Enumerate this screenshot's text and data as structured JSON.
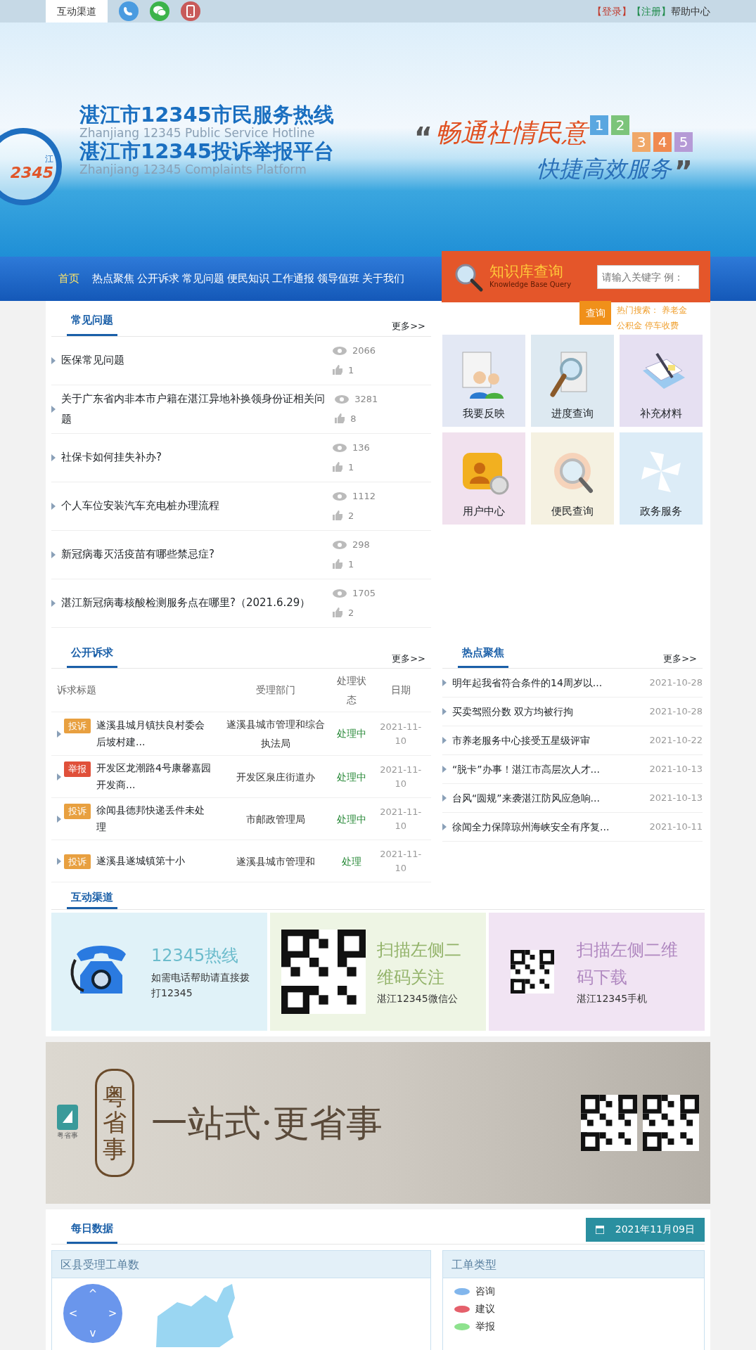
{
  "top_bar": {
    "channel_label": "互动渠道",
    "links": [
      {
        "text": "【登录】",
        "color": "#c0392b"
      },
      {
        "text": "【注册】",
        "color": "#1e8a4a"
      },
      {
        "text": "帮助中心",
        "color": "#333333"
      }
    ]
  },
  "banner": {
    "logo_char": "江",
    "logo_number": "2345",
    "title_lines": [
      "湛江市12345市民服务热线",
      "Zhanjiang 12345 Public Service Hotline",
      "湛江市12345投诉举报平台",
      "Zhanjiang 12345 Complaints Platform"
    ],
    "quote_open": "“",
    "slogan_line1": "畅通社情民意",
    "slogan_line2": "快捷高效服务",
    "quote_close": "”",
    "digits": [
      {
        "text": "1",
        "color": "#5aa7e0"
      },
      {
        "text": "2",
        "color": "#7cc47a"
      },
      {
        "text": "3",
        "color": "#f0a868"
      },
      {
        "text": "4",
        "color": "#f08a50"
      },
      {
        "text": "5",
        "color": "#b59ad6"
      }
    ]
  },
  "nav": {
    "items": [
      {
        "label": "首页",
        "selected": true
      },
      {
        "label": "热点聚焦",
        "selected": false
      },
      {
        "label": "公开诉求",
        "selected": false
      },
      {
        "label": "常见问题",
        "selected": false
      },
      {
        "label": "便民知识",
        "selected": false
      },
      {
        "label": "工作通报",
        "selected": false
      },
      {
        "label": "领导值班",
        "selected": false
      },
      {
        "label": "关于我们",
        "selected": false
      }
    ]
  },
  "knowledge": {
    "title": "知识库查询",
    "subtitle": "Knowledge Base Query",
    "placeholder": "请输入关键字 例：",
    "button": "查询",
    "hot_label": "热门搜索：",
    "hot_terms": [
      "养老金",
      "公积金",
      "停车收费"
    ]
  },
  "faq": {
    "title": "常见问题",
    "more": "更多>>",
    "items": [
      {
        "title": "医保常见问题",
        "views": "2066",
        "likes": "1"
      },
      {
        "title": "关于广东省内非本市户籍在湛江异地补换领身份证相关问题",
        "views": "3281",
        "likes": "8"
      },
      {
        "title": "社保卡如何挂失补办?",
        "views": "136",
        "likes": "1"
      },
      {
        "title": "个人车位安装汽车充电桩办理流程",
        "views": "1112",
        "likes": "2"
      },
      {
        "title": "新冠病毒灭活疫苗有哪些禁忌症?",
        "views": "298",
        "likes": "1"
      },
      {
        "title": "湛江新冠病毒核酸检测服务点在哪里?（2021.6.29）",
        "views": "1705",
        "likes": "2"
      }
    ]
  },
  "tiles": [
    {
      "label": "我要反映",
      "kind": "feedback",
      "color": "#e3e8f4"
    },
    {
      "label": "进度查询",
      "kind": "progress",
      "color": "#dde9f1"
    },
    {
      "label": "补充材料",
      "kind": "material",
      "color": "#e6e0f2"
    },
    {
      "label": "用户中心",
      "kind": "user",
      "color": "#f1e1ee"
    },
    {
      "label": "便民查询",
      "kind": "lookup",
      "color": "#f5f1e1"
    },
    {
      "label": "政务服务",
      "kind": "service",
      "color": "#dcecf7"
    }
  ],
  "complaints": {
    "title": "公开诉求",
    "more": "更多>>",
    "columns": [
      "诉求标题",
      "受理部门",
      "处理状态",
      "日期"
    ],
    "rows": [
      {
        "kind": "complaint",
        "tag": "投诉",
        "title": "遂溪县城月镇扶良村委会后坡村建...",
        "dept": "遂溪县城市管理和综合执法局",
        "status": "处理中",
        "date": "2021-11-10"
      },
      {
        "kind": "report",
        "tag": "举报",
        "title": "开发区龙潮路4号康馨嘉园开发商...",
        "dept": "开发区泉庄街道办",
        "status": "处理中",
        "date": "2021-11-10"
      },
      {
        "kind": "complaint",
        "tag": "投诉",
        "title": "徐闻县德邦快递丢件未处理",
        "dept": "市邮政管理局",
        "status": "处理中",
        "date": "2021-11-10"
      },
      {
        "kind": "complaint",
        "tag": "投诉",
        "title": "遂溪县遂城镇第十小",
        "dept": "遂溪县城市管理和",
        "status": "处理",
        "date": "2021-11-10"
      }
    ]
  },
  "hot_focus": {
    "title": "热点聚焦",
    "more": "更多>>",
    "items": [
      {
        "title": "明年起我省符合条件的14周岁以...",
        "date": "2021-10-28"
      },
      {
        "title": "买卖驾照分数 双方均被行拘",
        "date": "2021-10-28"
      },
      {
        "title": "市养老服务中心接受五星级评审",
        "date": "2021-10-22"
      },
      {
        "title": "“脱卡”办事！湛江市高层次人才...",
        "date": "2021-10-13"
      },
      {
        "title": "台风“圆规”来袭湛江防风应急响...",
        "date": "2021-10-13"
      },
      {
        "title": "徐闻全力保障琼州海峡安全有序复...",
        "date": "2021-10-11"
      }
    ]
  },
  "channels": {
    "title": "互动渠道",
    "cards": [
      {
        "kind": "phone",
        "heading": "12345热线",
        "text": "如需电话帮助请直接拨打12345"
      },
      {
        "kind": "wechat",
        "heading": "扫描左侧二维码关注",
        "text": "湛江12345微信公"
      },
      {
        "kind": "app",
        "heading": "扫描左侧二维码下载",
        "text": "湛江12345手机"
      }
    ]
  },
  "ad": {
    "logo_text": "粤省事",
    "vertical_text": "粤省事",
    "slogan": "一站式·更省事"
  },
  "daily": {
    "title": "每日数据",
    "date": "2021年11月09日",
    "map_title": "区县受理工单数",
    "pan_arrows": [
      "^",
      "<",
      ">",
      "v"
    ],
    "type_title": "工单类型",
    "legend": [
      {
        "label": "咨询",
        "color": "#82b6ec"
      },
      {
        "label": "建议",
        "color": "#e5606b"
      },
      {
        "label": "举报",
        "color": "#8ee28e"
      }
    ]
  }
}
